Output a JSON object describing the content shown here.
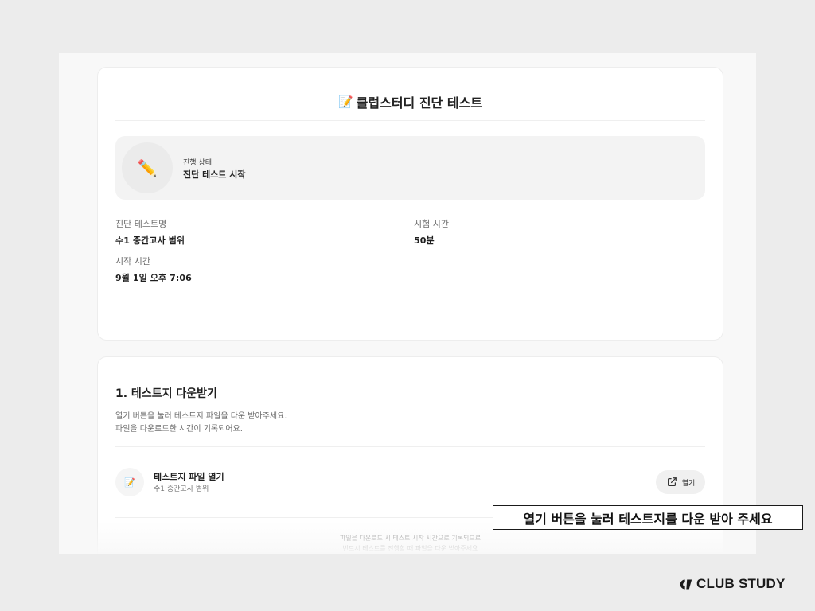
{
  "header": {
    "icon": "memo-icon",
    "title": "클럽스터디 진단 테스트"
  },
  "status": {
    "icon": "pencil-icon",
    "label": "진행 상태",
    "value": "진단 테스트 시작"
  },
  "details": {
    "test_name_label": "진단 테스트명",
    "test_name_value": "수1 중간고사 범위",
    "duration_label": "시험 시간",
    "duration_value": "50분",
    "start_label": "시작 시간",
    "start_value": "9월 1일 오후 7:06"
  },
  "download_section": {
    "title": "1. 테스트지 다운받기",
    "desc_line1": "열기 버튼을 눌러 테스트지 파일을 다운 받아주세요.",
    "desc_line2": "파일을 다운로드한 시간이 기록되어요.",
    "file": {
      "icon": "memo-icon",
      "title": "테스트지 파일 열기",
      "subtitle": "수1 중간고사 범위",
      "open_label": "열기",
      "open_icon": "external-link-icon"
    },
    "footnote_line1": "파일을 다운로드 시 테스트 시작 시간으로 기록되므로",
    "footnote_line2": "반드시 테스트를 진행할 때 파일을 다운 받아주세요"
  },
  "caption": "열기 버튼을 눌러 테스트지를 다운 받아 주세요",
  "brand": {
    "icon": "club-study-logo-icon",
    "text": "CLUB STUDY"
  }
}
